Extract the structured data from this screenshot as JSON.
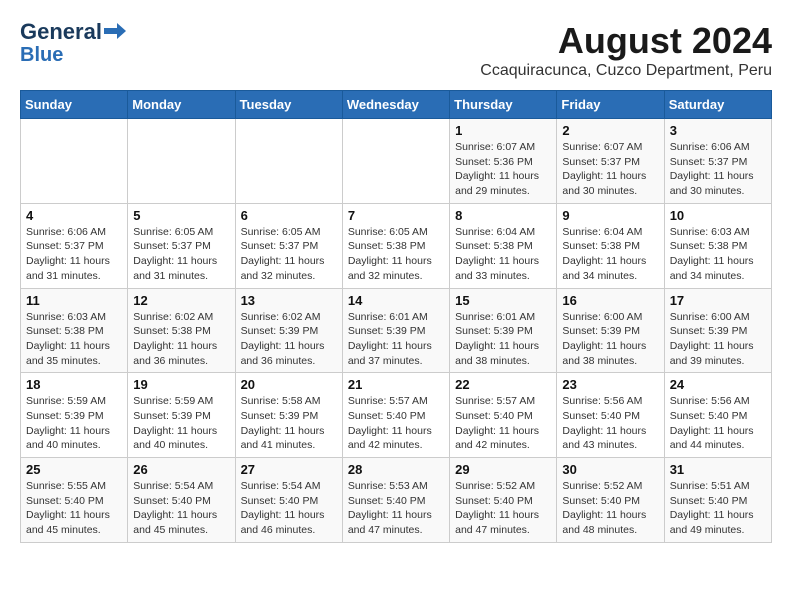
{
  "header": {
    "logo_line1": "General",
    "logo_line2": "Blue",
    "main_title": "August 2024",
    "subtitle": "Ccaquiracunca, Cuzco Department, Peru"
  },
  "calendar": {
    "days_of_week": [
      "Sunday",
      "Monday",
      "Tuesday",
      "Wednesday",
      "Thursday",
      "Friday",
      "Saturday"
    ],
    "weeks": [
      [
        {
          "day": "",
          "info": ""
        },
        {
          "day": "",
          "info": ""
        },
        {
          "day": "",
          "info": ""
        },
        {
          "day": "",
          "info": ""
        },
        {
          "day": "1",
          "info": "Sunrise: 6:07 AM\nSunset: 5:36 PM\nDaylight: 11 hours\nand 29 minutes."
        },
        {
          "day": "2",
          "info": "Sunrise: 6:07 AM\nSunset: 5:37 PM\nDaylight: 11 hours\nand 30 minutes."
        },
        {
          "day": "3",
          "info": "Sunrise: 6:06 AM\nSunset: 5:37 PM\nDaylight: 11 hours\nand 30 minutes."
        }
      ],
      [
        {
          "day": "4",
          "info": "Sunrise: 6:06 AM\nSunset: 5:37 PM\nDaylight: 11 hours\nand 31 minutes."
        },
        {
          "day": "5",
          "info": "Sunrise: 6:05 AM\nSunset: 5:37 PM\nDaylight: 11 hours\nand 31 minutes."
        },
        {
          "day": "6",
          "info": "Sunrise: 6:05 AM\nSunset: 5:37 PM\nDaylight: 11 hours\nand 32 minutes."
        },
        {
          "day": "7",
          "info": "Sunrise: 6:05 AM\nSunset: 5:38 PM\nDaylight: 11 hours\nand 32 minutes."
        },
        {
          "day": "8",
          "info": "Sunrise: 6:04 AM\nSunset: 5:38 PM\nDaylight: 11 hours\nand 33 minutes."
        },
        {
          "day": "9",
          "info": "Sunrise: 6:04 AM\nSunset: 5:38 PM\nDaylight: 11 hours\nand 34 minutes."
        },
        {
          "day": "10",
          "info": "Sunrise: 6:03 AM\nSunset: 5:38 PM\nDaylight: 11 hours\nand 34 minutes."
        }
      ],
      [
        {
          "day": "11",
          "info": "Sunrise: 6:03 AM\nSunset: 5:38 PM\nDaylight: 11 hours\nand 35 minutes."
        },
        {
          "day": "12",
          "info": "Sunrise: 6:02 AM\nSunset: 5:38 PM\nDaylight: 11 hours\nand 36 minutes."
        },
        {
          "day": "13",
          "info": "Sunrise: 6:02 AM\nSunset: 5:39 PM\nDaylight: 11 hours\nand 36 minutes."
        },
        {
          "day": "14",
          "info": "Sunrise: 6:01 AM\nSunset: 5:39 PM\nDaylight: 11 hours\nand 37 minutes."
        },
        {
          "day": "15",
          "info": "Sunrise: 6:01 AM\nSunset: 5:39 PM\nDaylight: 11 hours\nand 38 minutes."
        },
        {
          "day": "16",
          "info": "Sunrise: 6:00 AM\nSunset: 5:39 PM\nDaylight: 11 hours\nand 38 minutes."
        },
        {
          "day": "17",
          "info": "Sunrise: 6:00 AM\nSunset: 5:39 PM\nDaylight: 11 hours\nand 39 minutes."
        }
      ],
      [
        {
          "day": "18",
          "info": "Sunrise: 5:59 AM\nSunset: 5:39 PM\nDaylight: 11 hours\nand 40 minutes."
        },
        {
          "day": "19",
          "info": "Sunrise: 5:59 AM\nSunset: 5:39 PM\nDaylight: 11 hours\nand 40 minutes."
        },
        {
          "day": "20",
          "info": "Sunrise: 5:58 AM\nSunset: 5:39 PM\nDaylight: 11 hours\nand 41 minutes."
        },
        {
          "day": "21",
          "info": "Sunrise: 5:57 AM\nSunset: 5:40 PM\nDaylight: 11 hours\nand 42 minutes."
        },
        {
          "day": "22",
          "info": "Sunrise: 5:57 AM\nSunset: 5:40 PM\nDaylight: 11 hours\nand 42 minutes."
        },
        {
          "day": "23",
          "info": "Sunrise: 5:56 AM\nSunset: 5:40 PM\nDaylight: 11 hours\nand 43 minutes."
        },
        {
          "day": "24",
          "info": "Sunrise: 5:56 AM\nSunset: 5:40 PM\nDaylight: 11 hours\nand 44 minutes."
        }
      ],
      [
        {
          "day": "25",
          "info": "Sunrise: 5:55 AM\nSunset: 5:40 PM\nDaylight: 11 hours\nand 45 minutes."
        },
        {
          "day": "26",
          "info": "Sunrise: 5:54 AM\nSunset: 5:40 PM\nDaylight: 11 hours\nand 45 minutes."
        },
        {
          "day": "27",
          "info": "Sunrise: 5:54 AM\nSunset: 5:40 PM\nDaylight: 11 hours\nand 46 minutes."
        },
        {
          "day": "28",
          "info": "Sunrise: 5:53 AM\nSunset: 5:40 PM\nDaylight: 11 hours\nand 47 minutes."
        },
        {
          "day": "29",
          "info": "Sunrise: 5:52 AM\nSunset: 5:40 PM\nDaylight: 11 hours\nand 47 minutes."
        },
        {
          "day": "30",
          "info": "Sunrise: 5:52 AM\nSunset: 5:40 PM\nDaylight: 11 hours\nand 48 minutes."
        },
        {
          "day": "31",
          "info": "Sunrise: 5:51 AM\nSunset: 5:40 PM\nDaylight: 11 hours\nand 49 minutes."
        }
      ]
    ]
  }
}
